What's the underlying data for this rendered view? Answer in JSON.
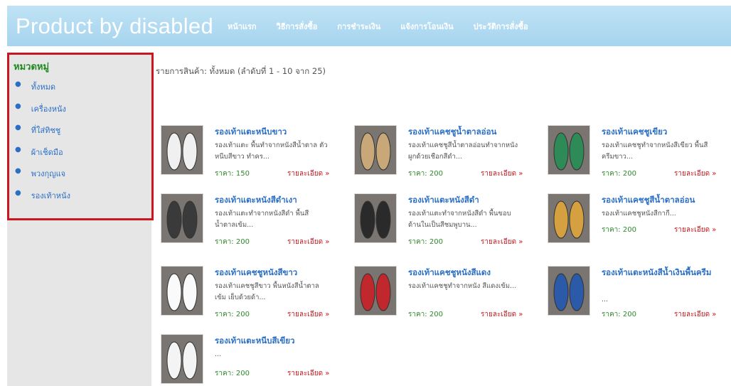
{
  "header": {
    "site_title": "Product by disabled",
    "nav": [
      "หน้าแรก",
      "วิธีการสั่งซื้อ",
      "การชำระเงิน",
      "แจ้งการโอนเงิน",
      "ประวัติการสั่งซื้อ"
    ]
  },
  "sidebar": {
    "title": "หมวดหมู่",
    "items": [
      "ทั้งหมด",
      "เครื่องหนัง",
      "ที่ใส่ทิชชู",
      "ผ้าเช็ดมือ",
      "พวงกุญแจ",
      "รองเท้าหนัง"
    ]
  },
  "listing": {
    "summary": "รายการสินค้า: ทั้งหมด (ลำดับที่ 1 - 10 จาก 25)"
  },
  "product_labels": {
    "price_prefix": "ราคา:",
    "details_link": "รายละเอียด »"
  },
  "products": [
    {
      "name": "รองเท้าแตะหนีบขาว",
      "desc": "รองเท้าแตะ พื้นทำจากหนังสีน้ำตาล ตัวหนีบสีขาว ทำคร...",
      "price": "150",
      "thumb_color": "#f0f0f0"
    },
    {
      "name": "รองเท้าแคชชูน้ำตาลอ่อน",
      "desc": "รองเท้าแคชชูสีน้ำตาลอ่อนทำจากหนัง ผูกด้วยเชือกสีดำ...",
      "price": "200",
      "thumb_color": "#c8a878"
    },
    {
      "name": "รองเท้าแคชชูเขียว",
      "desc": "รองเท้าแคชชูทำจากหนังสีเขียว พื้นสีครีมขาว...",
      "price": "200",
      "thumb_color": "#2e8b57"
    },
    {
      "name": "รองเท้าแตะหนังสีดำเงา",
      "desc": "รองเท้าแตะทำจากหนังสีดำ พื้นสีน้ำตาลเข้ม...",
      "price": "200",
      "thumb_color": "#3a3a3a"
    },
    {
      "name": "รองเท้าแตะหนังสีดำ",
      "desc": "รองเท้าแตะทำจากหนังสีดำ พื้นขอบด้านในเป็นสีชมพูบาน...",
      "price": "200",
      "thumb_color": "#2a2a2a"
    },
    {
      "name": "รองเท้าแคชชูสีน้ำตาลอ่อน",
      "desc": "รองเท้าแคชชูหนังสีกากี...",
      "price": "200",
      "thumb_color": "#d4a040"
    },
    {
      "name": "รองเท้าแคชชูหนังสีขาว",
      "desc": "รองเท้าแคชชูสีขาว พื้นหนังสีน้ำตาลเข้ม เย็บด้วยด้า...",
      "price": "200",
      "thumb_color": "#fafafa"
    },
    {
      "name": "รองเท้าแคชชูหนังสีแดง",
      "desc": "รองเท้าแคชชูทำจากหนัง สีแดงเข้ม...",
      "price": "200",
      "thumb_color": "#c0282d"
    },
    {
      "name": "รองเท้าแตะหนังสีน้ำเงินพื้นครีม",
      "desc": "...",
      "price": "200",
      "thumb_color": "#2a5aa8"
    },
    {
      "name": "รองเท้าแตะหนีบสีเขียว",
      "desc": "...",
      "price": "200",
      "thumb_color": "#f4f4f4"
    }
  ]
}
